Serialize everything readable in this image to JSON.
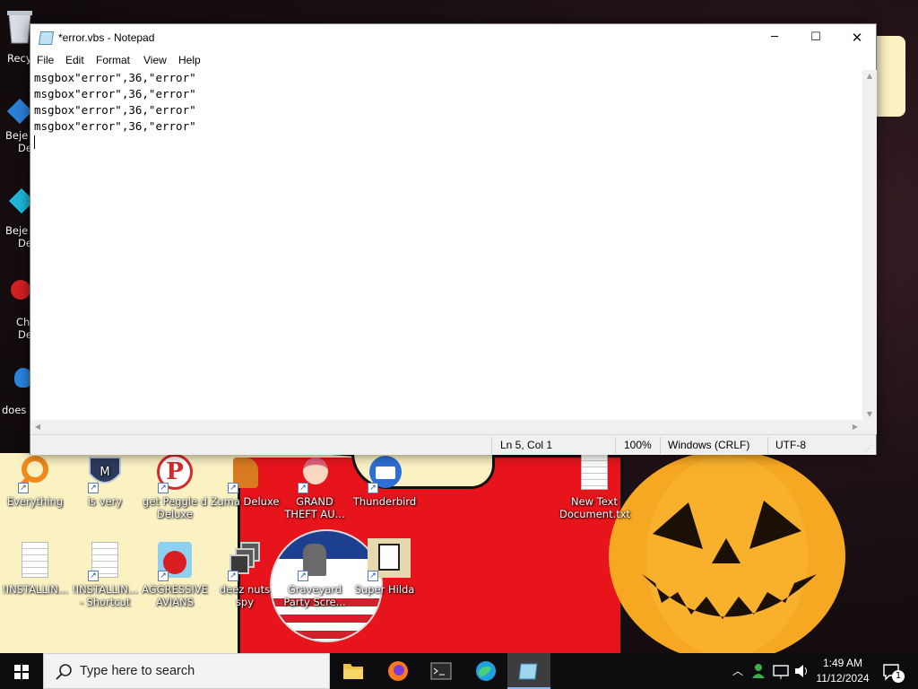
{
  "window": {
    "title": "*error.vbs - Notepad",
    "menu": [
      "File",
      "Edit",
      "Format",
      "View",
      "Help"
    ],
    "lines": [
      "msgbox\"error\",36,\"error\"",
      "msgbox\"error\",36,\"error\"",
      "msgbox\"error\",36,\"error\"",
      "msgbox\"error\",36,\"error\""
    ],
    "status": {
      "position": "Ln 5, Col 1",
      "zoom": "100%",
      "line_ending": "Windows (CRLF)",
      "encoding": "UTF-8"
    }
  },
  "desktop_left_partial": [
    "Recy",
    "Beje",
    "De",
    "Beje",
    "De",
    "Ch",
    "De",
    "does"
  ],
  "desktop_icons": [
    {
      "label": "Everything",
      "icon": "everything-icon",
      "color": "#f08a1c"
    },
    {
      "label": "is very",
      "icon": "shield-logo-icon",
      "color": "#2a3b5c"
    },
    {
      "label": "get Peggle d Deluxe",
      "icon": "peggle-icon",
      "color": "#d42a2a"
    },
    {
      "label": "Zuma Deluxe",
      "icon": "zuma-icon",
      "color": "#d87a20"
    },
    {
      "label": "GRAND THEFT AU...",
      "icon": "gta-girl-icon",
      "color": "#f4b6c2"
    },
    {
      "label": "Thunderbird",
      "icon": "thunderbird-icon",
      "color": "#2d6fd6"
    },
    {
      "label": "New Text Document.txt",
      "icon": "text-document-icon",
      "color": "#ffffff"
    },
    {
      "label": "!INSTALLIN...",
      "icon": "text-document-icon",
      "color": "#ffffff"
    },
    {
      "label": "!INSTALLIN... - Shortcut",
      "icon": "text-document-icon",
      "color": "#ffffff"
    },
    {
      "label": "AGGRESSIVE AVIANS",
      "icon": "angry-bird-icon",
      "color": "#d81e1e"
    },
    {
      "label": "deez nuts spy",
      "icon": "window-stack-icon",
      "color": "#5a5a5a"
    },
    {
      "label": "Graveyard Party Scre...",
      "icon": "graveyard-icon",
      "color": "#6a6a6a"
    },
    {
      "label": "Super Hilda",
      "icon": "pixel-dog-icon",
      "color": "#e8d8b0"
    }
  ],
  "taskbar": {
    "search_placeholder": "Type here to search",
    "apps": [
      {
        "name": "file-explorer",
        "icon": "folder-icon",
        "color": "#f0c040"
      },
      {
        "name": "firefox",
        "icon": "firefox-icon",
        "color": "#ff7a1a"
      },
      {
        "name": "terminal",
        "icon": "terminal-icon",
        "color": "#2b2b2b"
      },
      {
        "name": "edge",
        "icon": "edge-icon",
        "color": "#1fa0e0"
      },
      {
        "name": "notepad",
        "icon": "notepad-icon",
        "color": "#9fd6ef"
      }
    ],
    "time": "1:49 AM",
    "date": "11/12/2024",
    "notification_count": "1"
  }
}
